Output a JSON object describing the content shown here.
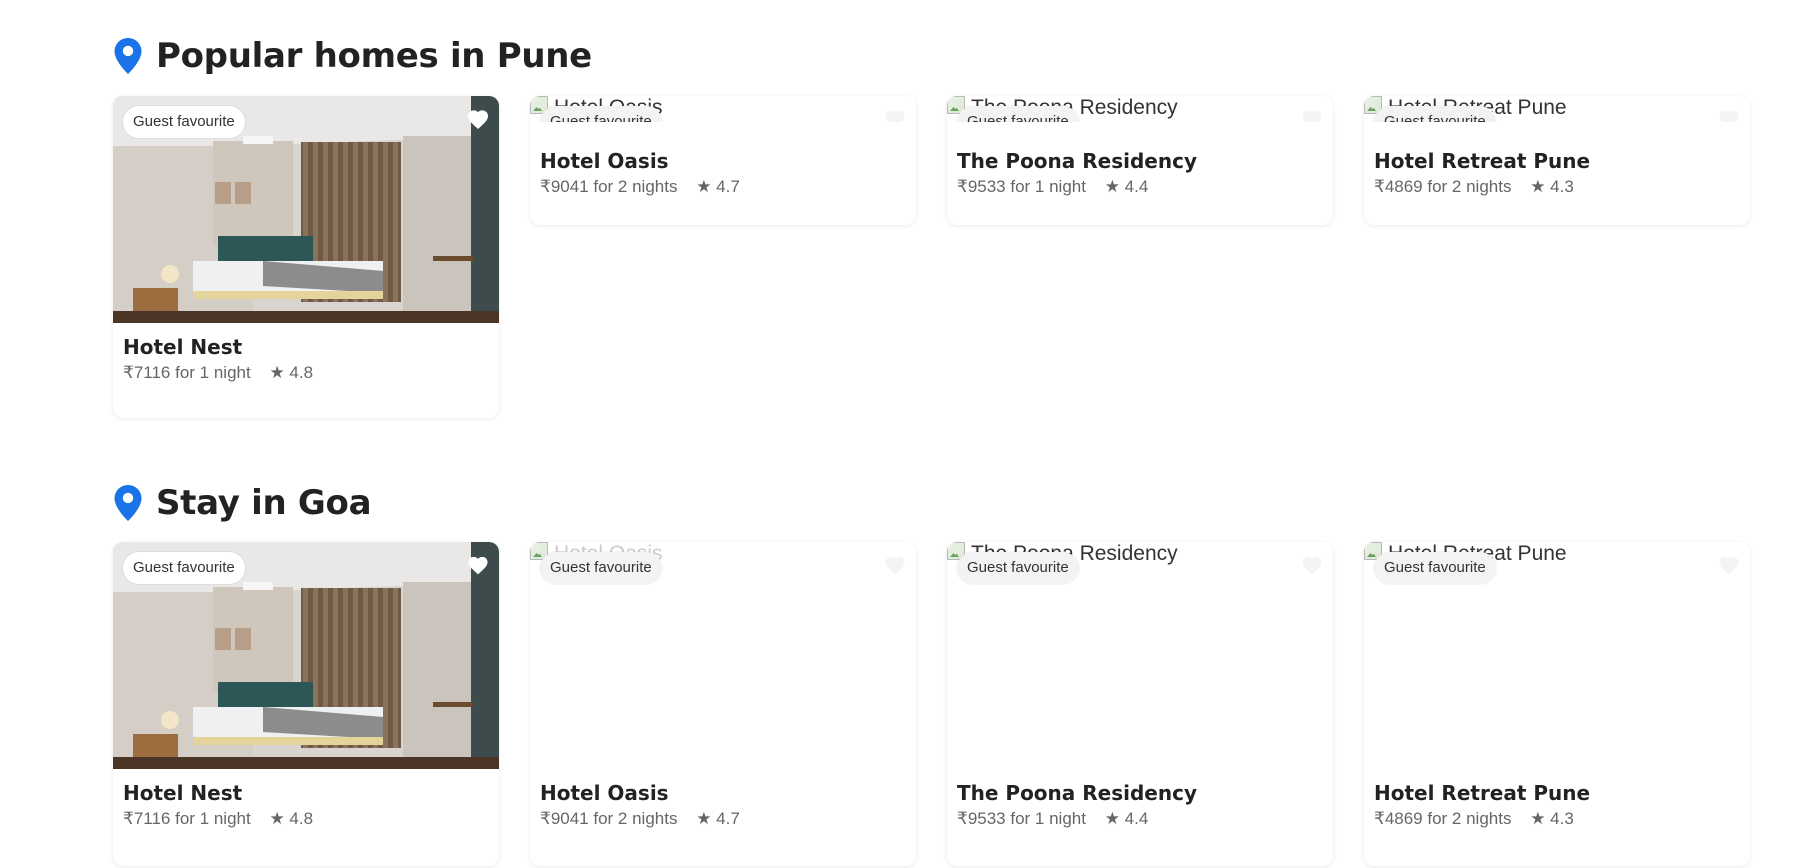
{
  "sections": [
    {
      "title": "Popular homes in Pune",
      "cards": [
        {
          "name": "Hotel Nest",
          "price": "₹7116 for 1 night",
          "rating": "★ 4.8",
          "badge": "Guest favourite",
          "alt": ""
        },
        {
          "name": "Hotel Oasis",
          "price": "₹9041 for 2 nights",
          "rating": "★ 4.7",
          "badge": "Guest favourite",
          "alt": "Hotel Oasis"
        },
        {
          "name": "The Poona Residency",
          "price": "₹9533 for 1 night",
          "rating": "★ 4.4",
          "badge": "Guest favourite",
          "alt": "The Poona Residency"
        },
        {
          "name": "Hotel Retreat Pune",
          "price": "₹4869 for 2 nights",
          "rating": "★ 4.3",
          "badge": "Guest favourite",
          "alt": "Hotel Retreat Pune"
        }
      ]
    },
    {
      "title": "Stay in Goa",
      "cards": [
        {
          "name": "Hotel Nest",
          "price": "₹7116 for 1 night",
          "rating": "★ 4.8",
          "badge": "Guest favourite",
          "alt": ""
        },
        {
          "name": "Hotel Oasis",
          "price": "₹9041 for 2 nights",
          "rating": "★ 4.7",
          "badge": "Guest favourite",
          "alt": "Hotel Oasis"
        },
        {
          "name": "The Poona Residency",
          "price": "₹9533 for 1 night",
          "rating": "★ 4.4",
          "badge": "Guest favourite",
          "alt": "The Poona Residency"
        },
        {
          "name": "Hotel Retreat Pune",
          "price": "₹4869 for 2 nights",
          "rating": "★ 4.3",
          "badge": "Guest favourite",
          "alt": "Hotel Retreat Pune"
        }
      ]
    }
  ],
  "icons": {
    "section_icon": "map-pin-icon",
    "favourite_icon": "heart-icon"
  },
  "colors": {
    "accent": "#1a73e8",
    "text": "#222222",
    "muted": "#666666"
  }
}
